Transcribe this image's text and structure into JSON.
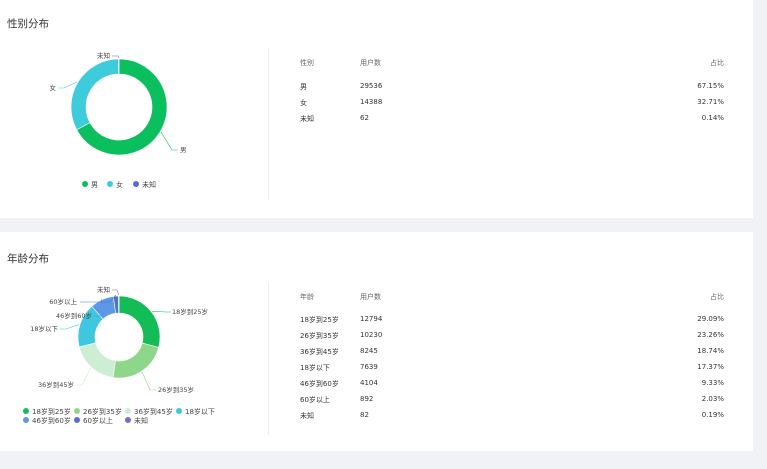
{
  "gender": {
    "title": "性别分布",
    "table": {
      "headers": [
        "性别",
        "用户数",
        "占比"
      ],
      "rows": [
        [
          "男",
          "29536",
          "67.15%"
        ],
        [
          "女",
          "14388",
          "32.71%"
        ],
        [
          "未知",
          "62",
          "0.14%"
        ]
      ]
    },
    "legend": [
      "男",
      "女",
      "未知"
    ],
    "chart_data": {
      "type": "pie",
      "title": "",
      "labels": [
        "男",
        "女",
        "未知"
      ],
      "values": [
        29536,
        14388,
        62
      ],
      "colors": [
        "#0bbf5f",
        "#3ecbdc",
        "#5470c6"
      ]
    }
  },
  "age": {
    "title": "年龄分布",
    "table": {
      "headers": [
        "年龄",
        "用户数",
        "占比"
      ],
      "rows": [
        [
          "18岁到25岁",
          "12794",
          "29.09%"
        ],
        [
          "26岁到35岁",
          "10230",
          "23.26%"
        ],
        [
          "36岁到45岁",
          "8245",
          "18.74%"
        ],
        [
          "18岁以下",
          "7639",
          "17.37%"
        ],
        [
          "46岁到60岁",
          "4104",
          "9.33%"
        ],
        [
          "60岁以上",
          "892",
          "2.03%"
        ],
        [
          "未知",
          "82",
          "0.19%"
        ]
      ]
    },
    "legend": [
      "18岁到25岁",
      "26岁到35岁",
      "36岁到45岁",
      "18岁以下",
      "46岁到60岁",
      "60岁以上",
      "未知"
    ],
    "chart_data": {
      "type": "pie",
      "title": "",
      "labels": [
        "18岁到25岁",
        "26岁到35岁",
        "36岁到45岁",
        "18岁以下",
        "46岁到60岁",
        "60岁以上",
        "未知"
      ],
      "values": [
        12794,
        10230,
        8245,
        7639,
        4104,
        892,
        82
      ],
      "colors": [
        "#13bc57",
        "#8ed68a",
        "#cdeed2",
        "#3ec7de",
        "#5b98e6",
        "#5472c4",
        "#8467c9"
      ]
    }
  }
}
